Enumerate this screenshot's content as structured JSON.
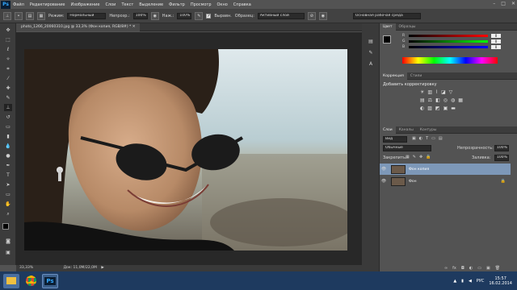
{
  "app": {
    "logo": "Ps"
  },
  "menu": [
    "Файл",
    "Редактирование",
    "Изображение",
    "Слои",
    "Текст",
    "Выделение",
    "Фильтр",
    "Просмотр",
    "Окно",
    "Справка"
  ],
  "options": {
    "mode_label": "Режим:",
    "mode_value": "Нормальный",
    "opacity_label": "Непрозр.:",
    "opacity_value": "100%",
    "pressure_label": "Наж.:",
    "pressure_value": "100%",
    "align_label": "Выравн.",
    "sample_label": "Образец:",
    "sample_value": "Активный слой",
    "workspace": "Основная рабочая среда"
  },
  "document": {
    "tab_title": "photo_1266_20060310.jpg @ 33,3% (Фон копия, RGB/8#) *",
    "zoom": "33,33%",
    "doc_info": "Док: 11,0М/22,0М"
  },
  "color_panel": {
    "tabs": [
      "Цвет",
      "Образцы"
    ],
    "sliders": [
      {
        "label": "R",
        "value": "0",
        "color": "#e03a3a"
      },
      {
        "label": "G",
        "value": "0",
        "color": "#3ac03a"
      },
      {
        "label": "B",
        "value": "0",
        "color": "#3a5ae0"
      }
    ]
  },
  "adjust_panel": {
    "tabs": [
      "Коррекция",
      "Стили"
    ],
    "title": "Добавить корректировку"
  },
  "layers_panel": {
    "tabs": [
      "Слои",
      "Каналы",
      "Контуры"
    ],
    "kind_filter": "Вид",
    "blend_mode": "Обычные",
    "opacity_label": "Непрозрачность:",
    "opacity_value": "100%",
    "lock_label": "Закрепить:",
    "fill_label": "Заливка:",
    "fill_value": "100%",
    "layers": [
      {
        "name": "Фон копия",
        "selected": true
      },
      {
        "name": "Фон",
        "selected": false
      }
    ]
  },
  "taskbar": {
    "lang": "РУС",
    "time": "15:57",
    "date": "16.02.2014"
  }
}
